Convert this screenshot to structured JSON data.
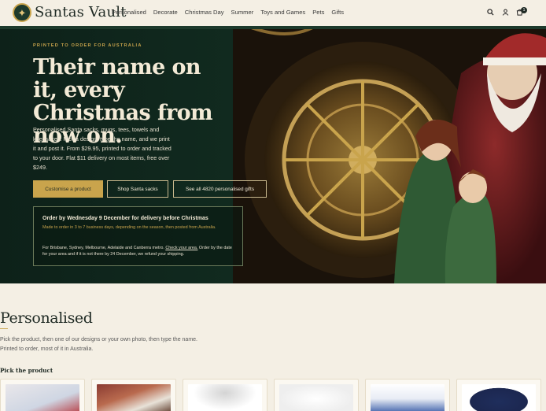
{
  "header": {
    "brand": "Santas Vault",
    "nav": [
      "Personalised",
      "Decorate",
      "Christmas Day",
      "Summer",
      "Toys and Games",
      "Pets",
      "Gifts"
    ],
    "cart_count": "1",
    "icons": [
      "search-icon",
      "account-icon",
      "cart-icon"
    ]
  },
  "hero": {
    "eyebrow": "PRINTED TO ORDER FOR AUSTRALIA",
    "title": "Their name on it, every Christmas from now on.",
    "body": "Personalised Santa sacks, mugs, tees, towels and keepsakes. Pick a design, type the name, and we print it and post it. From $29.95, printed to order and tracked to your door. Flat $11 delivery on most items, free over $249.",
    "buttons": {
      "primary": "Customise a product",
      "secondary": "Shop Santa sacks",
      "tertiary": "See all 4820 personalised gifts"
    },
    "notice": {
      "title": "Order by Wednesday 9 December for delivery before Christmas",
      "subtitle": "Made to order in 3 to 7 business days, depending on the season, then posted from Australia.",
      "metro_prefix": "For Brisbane, Sydney, Melbourne, Adelaide and Canberra metro.",
      "metro_link": "Check your area.",
      "metro_suffix": "Order by the date for your area and if it is not there by 24 December, we refund your shipping."
    }
  },
  "section": {
    "title": "Personalised",
    "description_line1": "Pick the product, then one of our designs or your own photo, then type the name.",
    "description_line2": "Printed to order, most of it in Australia.",
    "pick_label": "Pick the product"
  },
  "colors": {
    "accent_gold": "#c9a44c",
    "hero_green": "#112a1f",
    "page_bg": "#f4efe4"
  }
}
